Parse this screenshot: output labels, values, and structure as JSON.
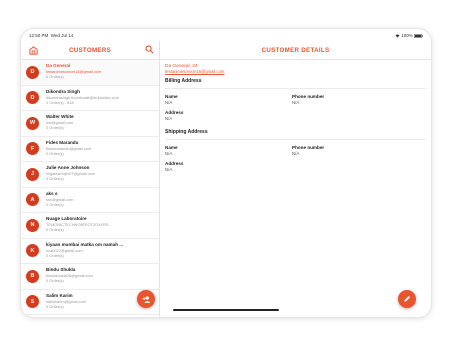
{
  "status": {
    "time": "12:50 PM",
    "date": "Wed Jul 14",
    "battery": "100%"
  },
  "left": {
    "title": "CUSTOMERS",
    "items": [
      {
        "initial": "D",
        "name": "Da General",
        "email": "testanimesonicm16@gmail.com",
        "orders": "0 Order(s)",
        "selected": true
      },
      {
        "initial": "D",
        "name": "Dikondra Singh",
        "email": "dikondrasingh.thundrwati@techactics.com",
        "orders": "1 Order(s) - $18",
        "selected": false
      },
      {
        "initial": "W",
        "name": "Walter White",
        "email": "ww@gmail.com",
        "orders": "0 Order(s)",
        "selected": false
      },
      {
        "initial": "F",
        "name": "Fides Marandu",
        "email": "fidesmarandu@gmail.com",
        "orders": "0 Order(s)",
        "selected": false
      },
      {
        "initial": "J",
        "name": "Julie Anne Johnson",
        "email": "virgalesmujer07@gmail.com",
        "orders": "0 Order(s)",
        "selected": false
      },
      {
        "initial": "A",
        "name": "aks s",
        "email": "sss@gmail.com",
        "orders": "0 Order(s)",
        "selected": false
      },
      {
        "initial": "N",
        "name": "Nuage Laboratoire",
        "email": "TEMONICTECHNO8FEOT2OAYRS...",
        "orders": "0 Order(s)",
        "selected": false
      },
      {
        "initial": "K",
        "name": "kiyaan mumbai matka om namah ...",
        "email": "nca0022@gmail.com",
        "orders": "0 Order(s)",
        "selected": false
      },
      {
        "initial": "B",
        "name": "Bindu Shukla",
        "email": "bindushukla26@gmail.com",
        "orders": "0 Order(s)",
        "selected": false
      },
      {
        "initial": "S",
        "name": "Salim Karim",
        "email": "salimkarim@gmail.com",
        "orders": "0 Order(s)",
        "selected": false
      }
    ],
    "fab_icon": "add-person-icon"
  },
  "right": {
    "title": "CUSTOMER DETAILS",
    "name_line": "Da General: 24",
    "email": "testanimesonicm16@gmail.com",
    "billing": {
      "heading": "Billing Address",
      "name_label": "Name",
      "name_value": "N/A",
      "phone_label": "Phone number",
      "phone_value": "N/A",
      "address_label": "Address",
      "address_value": "N/A"
    },
    "shipping": {
      "heading": "Shipping Address",
      "name_label": "Name",
      "name_value": "N/A",
      "phone_label": "Phone number",
      "phone_value": "N/A",
      "address_label": "Address",
      "address_value": "N/A"
    },
    "fab_icon": "edit-icon"
  },
  "colors": {
    "accent": "#e8552f",
    "avatar": "#d53b1f"
  }
}
